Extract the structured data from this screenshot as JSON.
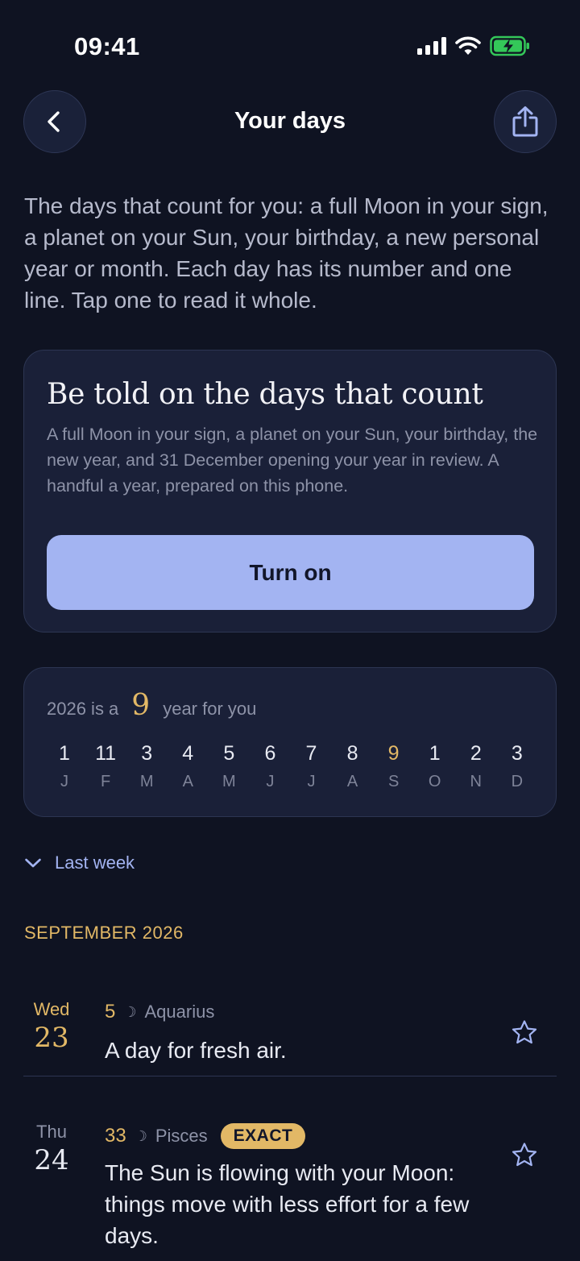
{
  "status_bar": {
    "time": "09:41"
  },
  "header": {
    "title": "Your days",
    "back_icon": "chevron-left-icon",
    "share_icon": "share-icon"
  },
  "intro": "The days that count for you: a full Moon in your sign, a planet on your Sun, your birthday, a new personal year or month. Each day has its number and one line. Tap one to read it whole.",
  "notify_card": {
    "title": "Be told on the days that count",
    "body": "A full Moon in your sign, a planet on your Sun, your birthday, the new year, and 31 December opening your year in review. A handful a year, prepared on this phone.",
    "button_label": "Turn on"
  },
  "year_card": {
    "prefix": "2026 is a",
    "number": "9",
    "suffix": "year for you",
    "months": [
      {
        "num": "1",
        "letter": "J"
      },
      {
        "num": "11",
        "letter": "F"
      },
      {
        "num": "3",
        "letter": "M"
      },
      {
        "num": "4",
        "letter": "A"
      },
      {
        "num": "5",
        "letter": "M"
      },
      {
        "num": "6",
        "letter": "J"
      },
      {
        "num": "7",
        "letter": "J"
      },
      {
        "num": "8",
        "letter": "A"
      },
      {
        "num": "9",
        "letter": "S"
      },
      {
        "num": "1",
        "letter": "O"
      },
      {
        "num": "2",
        "letter": "N"
      },
      {
        "num": "3",
        "letter": "D"
      }
    ],
    "current_month_index": 8
  },
  "last_week": {
    "label": "Last week",
    "icon": "chevron-down-icon"
  },
  "section": {
    "header": "SEPTEMBER 2026"
  },
  "days": [
    {
      "weekday": "Wed",
      "date": "23",
      "number": "5",
      "moon_glyph": "☽",
      "moon_sign": "Aquarius",
      "badge": "",
      "text": "A day for fresh air."
    },
    {
      "weekday": "Thu",
      "date": "24",
      "number": "33",
      "moon_glyph": "☽",
      "moon_sign": "Pisces",
      "badge": "EXACT",
      "text": "The Sun is flowing with your Moon: things move with less effort for a few days."
    }
  ],
  "colors": {
    "background": "#0f1322",
    "card": "#1a2038",
    "accent_gold": "#e2b866",
    "accent_blue": "#a3b4f2"
  }
}
